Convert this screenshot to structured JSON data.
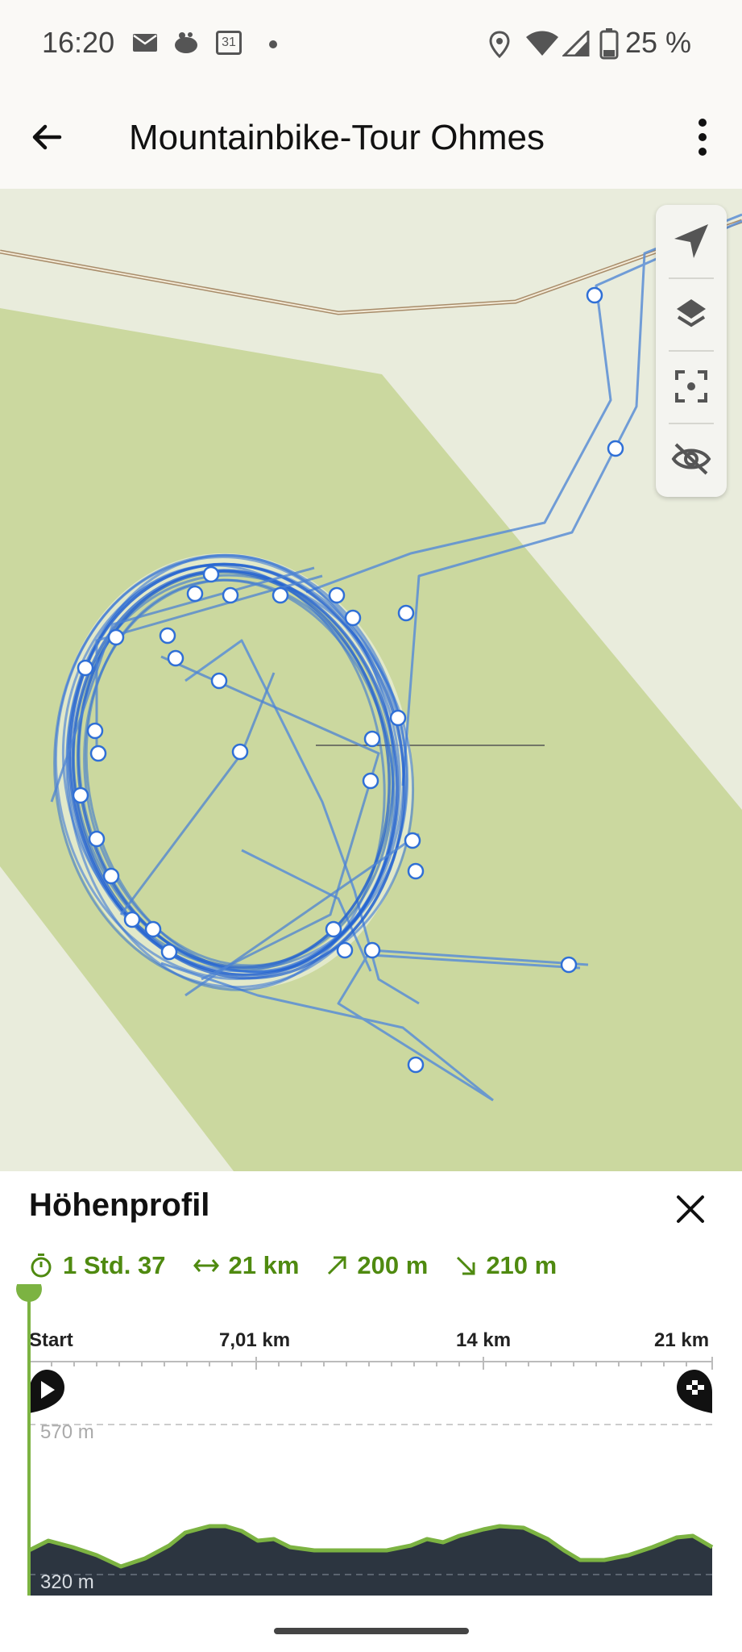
{
  "status_bar": {
    "time": "16:20",
    "notification_icons": [
      "gmail-icon",
      "app-icon",
      "calendar-icon",
      "dot-icon"
    ],
    "calendar_day": "31",
    "system_icons": [
      "location-icon",
      "wifi-icon",
      "signal-icon",
      "battery-icon"
    ],
    "battery": "25 %"
  },
  "app_bar": {
    "title": "Mountainbike-Tour Ohmes",
    "back_icon": "arrow-left-icon",
    "more_icon": "more-vertical-icon"
  },
  "map": {
    "controls": [
      "navigate-icon",
      "layers-icon",
      "locate-icon",
      "hide-icon"
    ],
    "track_color": "#2f6fd6",
    "forest_color": "#cbd89f",
    "field_color": "#e9ecdc"
  },
  "elevation_sheet": {
    "title": "Höhenprofil",
    "close_icon": "close-icon",
    "stats": {
      "duration": "1 Std. 37",
      "distance": "21 km",
      "ascent": "200 m",
      "descent": "210 m"
    },
    "axis_labels": [
      "Start",
      "7,01 km",
      "14 km",
      "21 km"
    ],
    "elevation_max": "570 m",
    "elevation_min": "320 m",
    "accent_color": "#7cb342",
    "profile_fill": "#2c3540"
  }
}
